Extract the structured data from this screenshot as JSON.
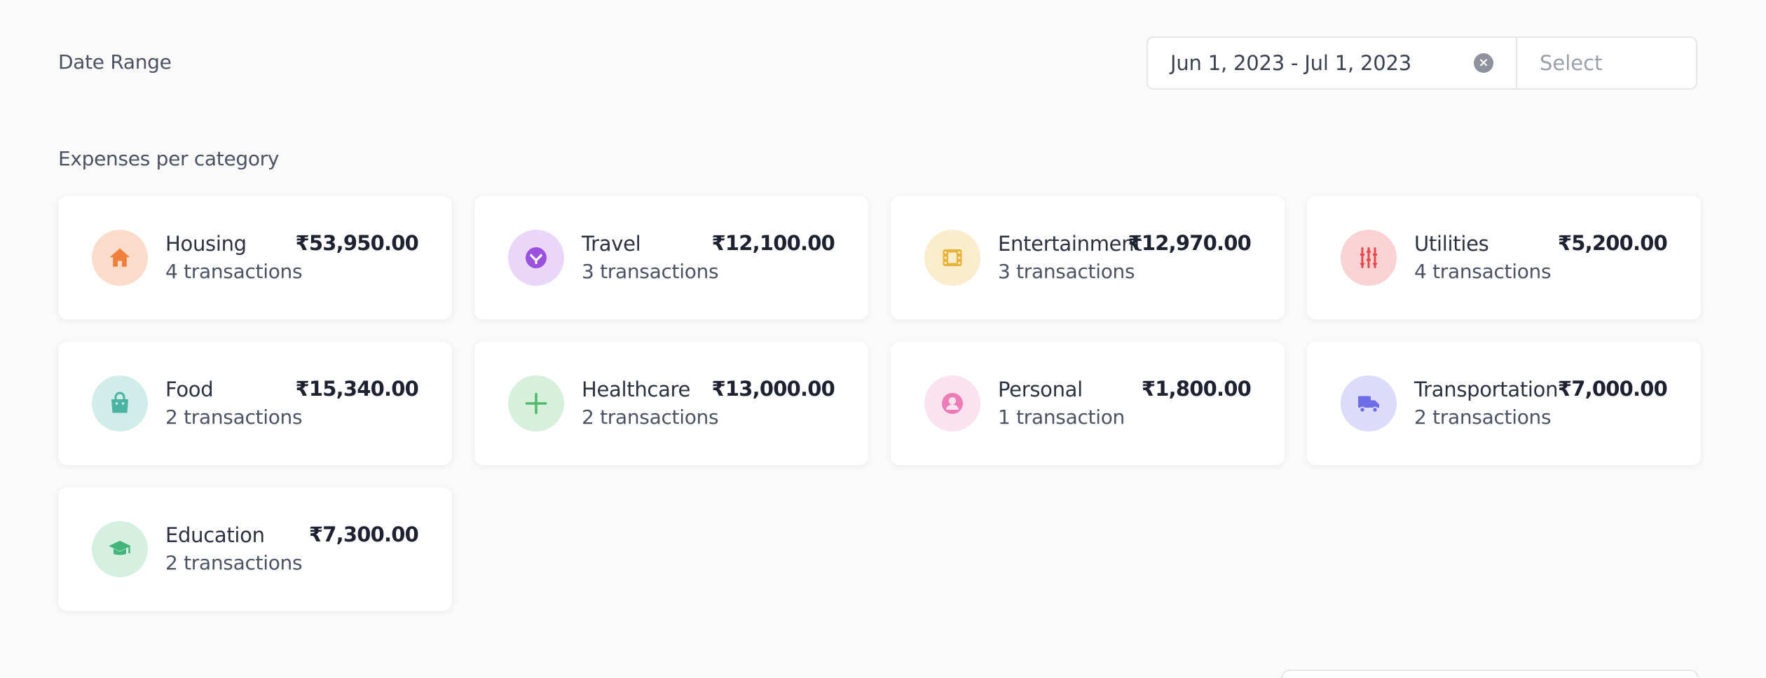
{
  "filters": {
    "date_range_label": "Date Range",
    "date_range_value": "Jun 1, 2023 - Jul 1, 2023",
    "select_placeholder": "Select"
  },
  "section": {
    "title": "Expenses per category"
  },
  "categories": [
    {
      "name": "Housing",
      "count": "4 transactions",
      "amount": "₹53,950.00",
      "icon": "home-icon",
      "icon_color": "#ef7f3a",
      "bg_color": "#fbdcca"
    },
    {
      "name": "Travel",
      "count": "3 transactions",
      "amount": "₹12,100.00",
      "icon": "plane-icon",
      "icon_color": "#9b51e0",
      "bg_color": "#e9d6f8"
    },
    {
      "name": "Entertainment",
      "count": "3 transactions",
      "amount": "₹12,970.00",
      "icon": "film-icon",
      "icon_color": "#e9b33a",
      "bg_color": "#fbeccd"
    },
    {
      "name": "Utilities",
      "count": "4 transactions",
      "amount": "₹5,200.00",
      "icon": "sliders-icon",
      "icon_color": "#e8484c",
      "bg_color": "#f9d3d4"
    },
    {
      "name": "Food",
      "count": "2 transactions",
      "amount": "₹15,340.00",
      "icon": "shopping-bag-icon",
      "icon_color": "#4bb3a4",
      "bg_color": "#d2ede9"
    },
    {
      "name": "Healthcare",
      "count": "2 transactions",
      "amount": "₹13,000.00",
      "icon": "plus-icon",
      "icon_color": "#52b96a",
      "bg_color": "#d6f0dc"
    },
    {
      "name": "Personal",
      "count": "1 transaction",
      "amount": "₹1,800.00",
      "icon": "user-circle-icon",
      "icon_color": "#ec7bb6",
      "bg_color": "#fbe2ef"
    },
    {
      "name": "Transportation",
      "count": "2 transactions",
      "amount": "₹7,000.00",
      "icon": "truck-icon",
      "icon_color": "#6e6ce6",
      "bg_color": "#dcdbf9"
    },
    {
      "name": "Education",
      "count": "2 transactions",
      "amount": "₹7,300.00",
      "icon": "graduation-cap-icon",
      "icon_color": "#43b57b",
      "bg_color": "#d5efe1"
    }
  ]
}
